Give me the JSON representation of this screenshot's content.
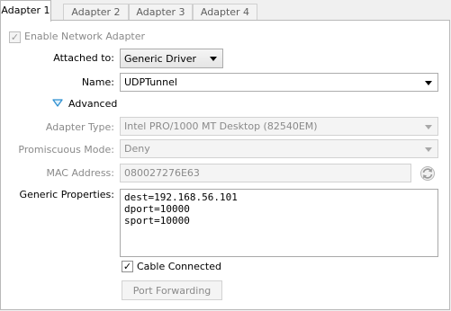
{
  "tabs": [
    {
      "label": "Adapter 1",
      "active": true
    },
    {
      "label": "Adapter 2",
      "active": false
    },
    {
      "label": "Adapter 3",
      "active": false
    },
    {
      "label": "Adapter 4",
      "active": false
    }
  ],
  "enable_adapter": {
    "label": "Enable Network Adapter",
    "checked": true
  },
  "attached_to": {
    "label": "Attached to:",
    "value": "Generic Driver"
  },
  "name": {
    "label": "Name:",
    "value": "UDPTunnel"
  },
  "advanced": {
    "label": "Advanced",
    "expanded": true
  },
  "adapter_type": {
    "label": "Adapter Type:",
    "value": "Intel PRO/1000 MT Desktop (82540EM)"
  },
  "promiscuous_mode": {
    "label": "Promiscuous Mode:",
    "value": "Deny"
  },
  "mac_address": {
    "label": "MAC Address:",
    "value": "080027276E63"
  },
  "generic_properties": {
    "label": "Generic Properties:",
    "lines": [
      "dest=192.168.56.101",
      "dport=10000",
      "sport=10000"
    ]
  },
  "cable_connected": {
    "label": "Cable Connected",
    "checked": true
  },
  "port_forwarding": {
    "label": "Port Forwarding"
  },
  "icons": {
    "refresh": "refresh-mac-icon",
    "expander": "triangle-down-icon"
  }
}
